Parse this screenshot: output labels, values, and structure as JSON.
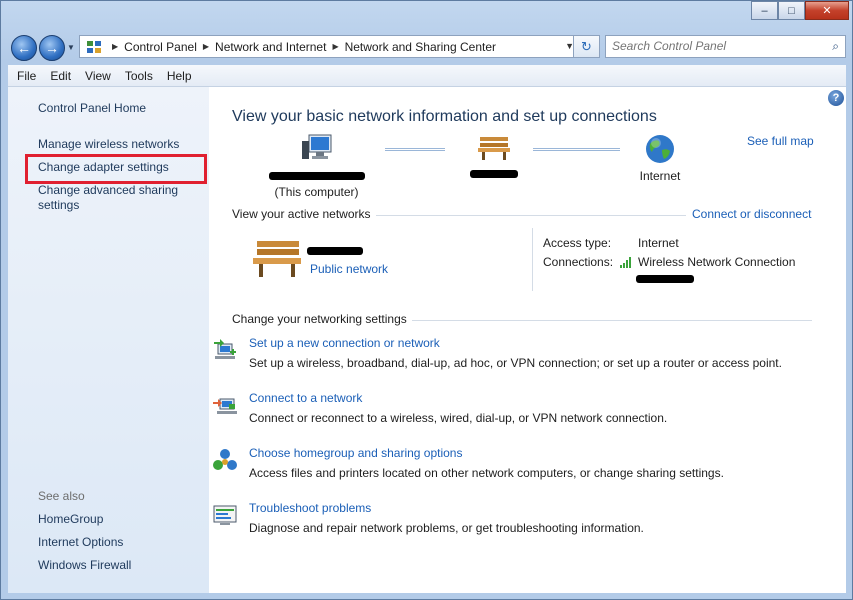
{
  "titlebar": {
    "ghost_text": "",
    "buttons": {
      "minimize": "–",
      "maximize": "□",
      "close": "✕"
    }
  },
  "address": {
    "back_icon": "back-arrow-icon",
    "forward_icon": "forward-arrow-icon",
    "breadcrumbs": [
      "Control Panel",
      "Network and Internet",
      "Network and Sharing Center"
    ],
    "search_placeholder": "Search Control Panel"
  },
  "menu": {
    "items": [
      "File",
      "Edit",
      "View",
      "Tools",
      "Help"
    ]
  },
  "sidebar": {
    "home": "Control Panel Home",
    "links": [
      "Manage wireless networks",
      "Change adapter settings",
      "Change advanced sharing settings"
    ],
    "see_also_label": "See also",
    "see_also": [
      "HomeGroup",
      "Internet Options",
      "Windows Firewall"
    ],
    "highlight_color": "#e02030"
  },
  "main": {
    "heading": "View your basic network information and set up connections",
    "see_full_map": "See full map",
    "map": {
      "computer_caption": "(This computer)",
      "internet_label": "Internet"
    },
    "active_networks_label": "View your active networks",
    "connect_disconnect": "Connect or disconnect",
    "network_type": "Public network",
    "access_type_label": "Access type:",
    "access_type_value": "Internet",
    "connections_label": "Connections:",
    "connections_value": "Wireless Network Connection",
    "change_settings_label": "Change your networking settings",
    "tasks": [
      {
        "title": "Set up a new connection or network",
        "desc": "Set up a wireless, broadband, dial-up, ad hoc, or VPN connection; or set up a router or access point.",
        "icon": "new-connection-icon"
      },
      {
        "title": "Connect to a network",
        "desc": "Connect or reconnect to a wireless, wired, dial-up, or VPN network connection.",
        "icon": "connect-network-icon"
      },
      {
        "title": "Choose homegroup and sharing options",
        "desc": "Access files and printers located on other network computers, or change sharing settings.",
        "icon": "homegroup-icon"
      },
      {
        "title": "Troubleshoot problems",
        "desc": "Diagnose and repair network problems, or get troubleshooting information.",
        "icon": "troubleshoot-icon"
      }
    ]
  },
  "colors": {
    "link": "#1b5fb7",
    "heading": "#1e395b",
    "sidebar_bg": "#dce8f6"
  }
}
